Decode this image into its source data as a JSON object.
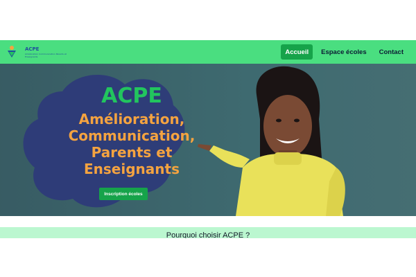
{
  "brand": {
    "name": "ACPE",
    "tagline": "Amélioration Communication Parents et Enseignants"
  },
  "nav": {
    "items": [
      {
        "label": "Accueil",
        "active": true
      },
      {
        "label": "Espace écoles",
        "active": false
      },
      {
        "label": "Contact",
        "active": false
      }
    ]
  },
  "hero": {
    "title": "ACPE",
    "subtitle_lines": [
      "Amélioration,",
      "Communication,",
      "Parents et",
      "Enseignants"
    ],
    "cta_label": "Inscription écoles"
  },
  "section": {
    "title": "Pourquoi choisir ACPE ?"
  },
  "colors": {
    "nav_bg": "#4ade80",
    "accent_green": "#16a34a",
    "title_green": "#22c55e",
    "subtitle_orange": "#f4a340",
    "hero_bg": "#3f6a6f",
    "section_bg": "#bbf7d0"
  }
}
